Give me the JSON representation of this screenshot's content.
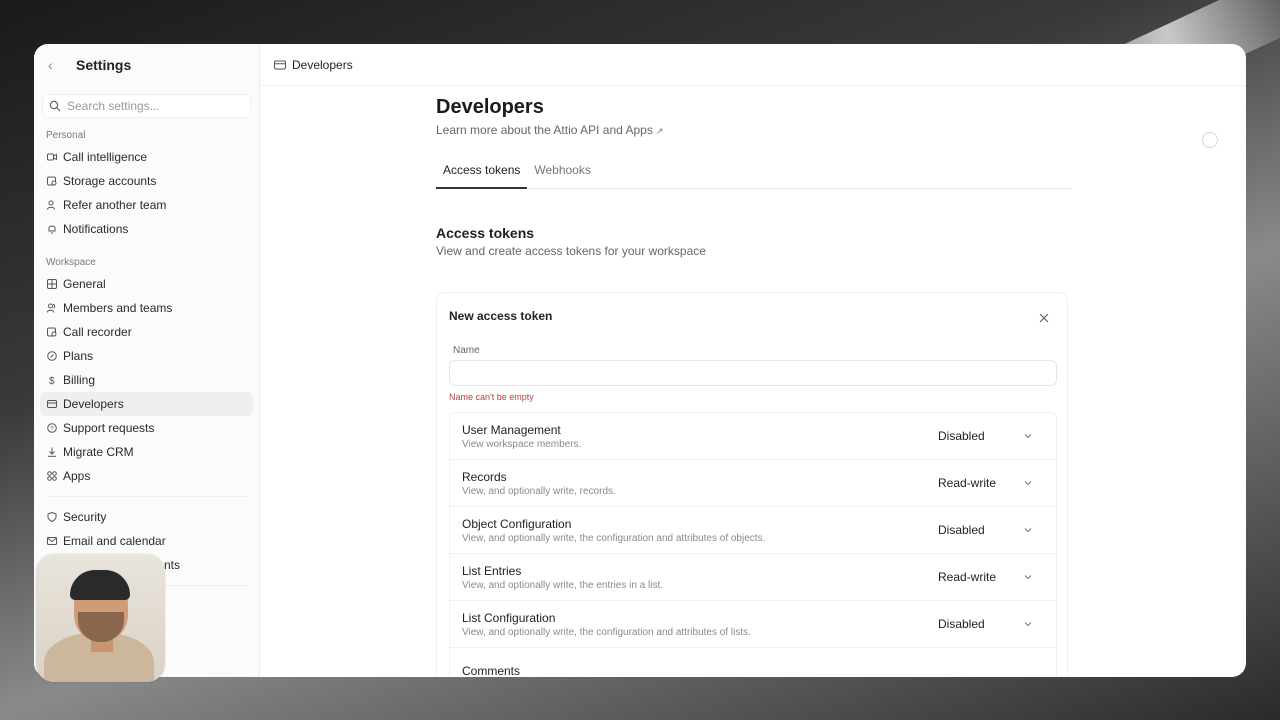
{
  "sidebar": {
    "title": "Settings",
    "search_placeholder": "Search settings...",
    "sections": [
      {
        "label": "Personal"
      },
      {
        "label": "Workspace"
      }
    ],
    "personal_items": [
      {
        "label": "Call intelligence",
        "icon": "video-icon"
      },
      {
        "label": "Storage accounts",
        "icon": "storage-icon"
      },
      {
        "label": "Refer another team",
        "icon": "users-icon"
      },
      {
        "label": "Notifications",
        "icon": "bell-icon"
      }
    ],
    "workspace_items": [
      {
        "label": "General",
        "icon": "grid-icon"
      },
      {
        "label": "Members and teams",
        "icon": "users-icon"
      },
      {
        "label": "Call recorder",
        "icon": "recorder-icon"
      },
      {
        "label": "Plans",
        "icon": "plans-icon"
      },
      {
        "label": "Billing",
        "icon": "dollar-icon"
      },
      {
        "label": "Developers",
        "icon": "developers-icon"
      },
      {
        "label": "Support requests",
        "icon": "help-icon"
      },
      {
        "label": "Migrate CRM",
        "icon": "download-icon"
      },
      {
        "label": "Apps",
        "icon": "apps-icon"
      }
    ],
    "security_items": [
      {
        "label": "Security",
        "icon": "shield-icon"
      },
      {
        "label": "Email and calendar",
        "icon": "mail-icon"
      },
      {
        "label": "nts",
        "icon": "accounts-icon"
      }
    ]
  },
  "topbar": {
    "label": "Developers"
  },
  "page": {
    "title": "Developers",
    "subtitle": "Learn more about the Attio API and Apps",
    "ext_glyph": "↗"
  },
  "tabs": [
    {
      "label": "Access tokens"
    },
    {
      "label": "Webhooks"
    }
  ],
  "section": {
    "title": "Access tokens",
    "subtitle": "View and create access tokens for your workspace"
  },
  "card": {
    "title": "New access token",
    "field_label": "Name",
    "field_value": "",
    "error": "Name can't be empty",
    "permissions": [
      {
        "name": "User Management",
        "desc": "View workspace members.",
        "value": "Disabled"
      },
      {
        "name": "Records",
        "desc": "View, and optionally write, records.",
        "value": "Read-write"
      },
      {
        "name": "Object Configuration",
        "desc": "View, and optionally write, the configuration and attributes of objects.",
        "value": "Disabled"
      },
      {
        "name": "List Entries",
        "desc": "View, and optionally write, the entries in a list.",
        "value": "Read-write"
      },
      {
        "name": "List Configuration",
        "desc": "View, and optionally write, the configuration and attributes of lists.",
        "value": "Disabled"
      },
      {
        "name": "Comments",
        "desc": "",
        "value": ""
      }
    ]
  }
}
